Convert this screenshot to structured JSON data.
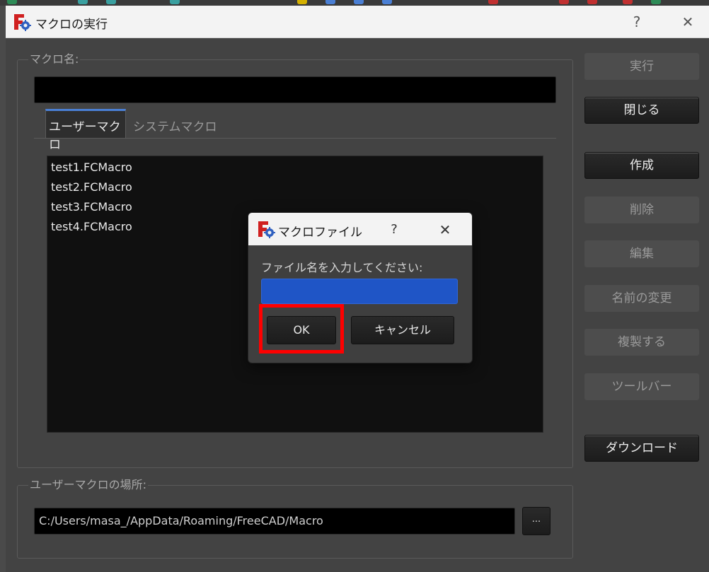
{
  "window": {
    "title": "マクロの実行",
    "help_glyph": "?",
    "close_glyph": "✕"
  },
  "macro_name": {
    "label": "マクロ名:",
    "value": ""
  },
  "tabs": [
    {
      "label": "ユーザーマクロ",
      "active": true
    },
    {
      "label": "システムマクロ",
      "active": false
    }
  ],
  "macros": [
    "test1.FCMacro",
    "test2.FCMacro",
    "test3.FCMacro",
    "test4.FCMacro"
  ],
  "side_buttons": {
    "execute": {
      "label": "実行",
      "enabled": false
    },
    "close": {
      "label": "閉じる",
      "enabled": true
    },
    "create": {
      "label": "作成",
      "enabled": true
    },
    "delete": {
      "label": "削除",
      "enabled": false
    },
    "edit": {
      "label": "編集",
      "enabled": false
    },
    "rename": {
      "label": "名前の変更",
      "enabled": false
    },
    "duplicate": {
      "label": "複製する",
      "enabled": false
    },
    "toolbar": {
      "label": "ツールバー",
      "enabled": false
    },
    "download": {
      "label": "ダウンロード",
      "enabled": true
    }
  },
  "location": {
    "label": "ユーザーマクロの場所:",
    "path": "C:/Users/masa_/AppData/Roaming/FreeCAD/Macro",
    "browse_label": "..."
  },
  "dialog": {
    "title": "マクロファイル",
    "help_glyph": "?",
    "close_glyph": "✕",
    "prompt": "ファイル名を入力してください:",
    "input_value": "",
    "ok_label": "OK",
    "cancel_label": "キャンセル"
  },
  "colors": {
    "highlight": "#ff0000",
    "selection": "#1f55c6",
    "tab_accent": "#4a7fd4"
  }
}
